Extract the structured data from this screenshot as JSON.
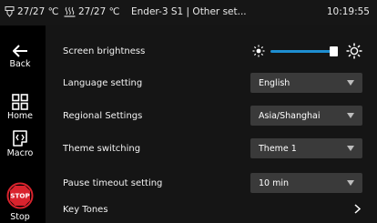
{
  "statusbar": {
    "nozzle_temp": "27/27 ℃",
    "bed_temp": "27/27 ℃",
    "breadcrumb": "Ender-3 S1 | Other set...",
    "clock": "10:19:55"
  },
  "sidebar": {
    "back": "Back",
    "home": "Home",
    "macro": "Macro",
    "stop": "Stop",
    "stop_badge": "STOP"
  },
  "settings": {
    "brightness": {
      "label": "Screen brightness",
      "level": 0.85
    },
    "language": {
      "label": "Language setting",
      "value": "English"
    },
    "region": {
      "label": "Regional Settings",
      "value": "Asia/Shanghai"
    },
    "theme": {
      "label": "Theme switching",
      "value": "Theme 1"
    },
    "pause_timeout": {
      "label": "Pause timeout setting",
      "value": "10 min"
    },
    "key_tones": {
      "label": "Key Tones"
    }
  },
  "colors": {
    "accent": "#1e8ed1",
    "stop_red": "#d9232d",
    "select_bg": "#3a3a3a",
    "panel_bg": "#151515"
  },
  "icons": [
    "nozzle-icon",
    "bed-icon",
    "back-arrow-icon",
    "home-grid-icon",
    "macro-icon",
    "stop-icon",
    "sun-small-icon",
    "sun-large-icon",
    "caret-down-icon",
    "chevron-right-icon"
  ]
}
